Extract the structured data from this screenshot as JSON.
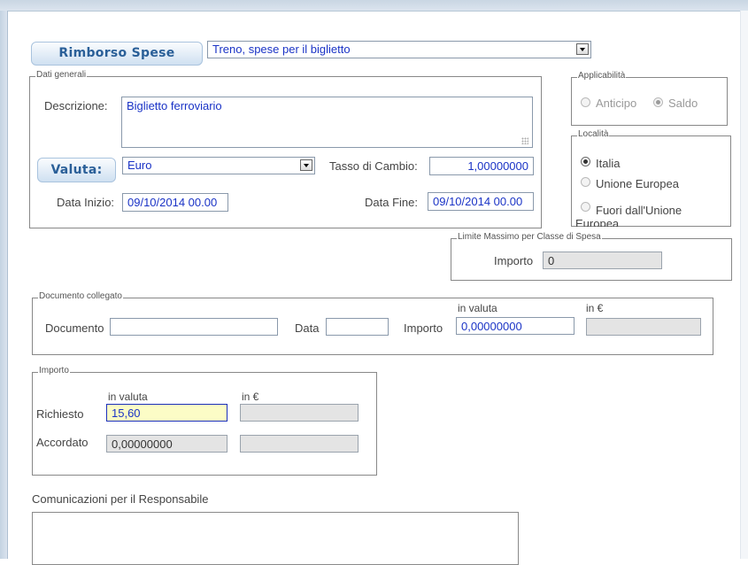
{
  "header": {
    "title": "Rimborso Spese",
    "type_value": "Treno, spese per il biglietto"
  },
  "dati_generali": {
    "legend": "Dati generali",
    "descrizione_label": "Descrizione:",
    "descrizione_value": "Biglietto ferroviario",
    "valuta_button": "Valuta:",
    "valuta_value": "Euro",
    "tasso_label": "Tasso di Cambio:",
    "tasso_value": "1,00000000",
    "data_inizio_label": "Data Inizio:",
    "data_inizio_value": "09/10/2014 00.00",
    "data_fine_label": "Data Fine:",
    "data_fine_value": "09/10/2014 00.00"
  },
  "applicabilita": {
    "legend": "Applicabilità",
    "anticipo": "Anticipo",
    "saldo": "Saldo",
    "selected": "saldo"
  },
  "localita": {
    "legend": "Località",
    "italia": "Italia",
    "ue": "Unione Europea",
    "extra_ue": "Fuori dall'Unione Europea",
    "selected": "italia"
  },
  "limite": {
    "legend": "Limite Massimo per Classe di Spesa",
    "importo_label": "Importo",
    "importo_value": "0"
  },
  "documento": {
    "legend": "Documento collegato",
    "documento_label": "Documento",
    "documento_value": "",
    "data_label": "Data",
    "data_value": "",
    "importo_label": "Importo",
    "in_valuta_label": "in valuta",
    "in_euro_label": "in €",
    "importo_valuta_value": "0,00000000",
    "importo_euro_value": ""
  },
  "importo": {
    "legend": "Importo",
    "in_valuta_label": "in valuta",
    "in_euro_label": "in €",
    "richiesto_label": "Richiesto",
    "richiesto_valuta": "15,60",
    "richiesto_euro": "",
    "accordato_label": "Accordato",
    "accordato_valuta": "0,00000000",
    "accordato_euro": ""
  },
  "comunicazioni": {
    "label": "Comunicazioni per il Responsabile",
    "value": ""
  }
}
